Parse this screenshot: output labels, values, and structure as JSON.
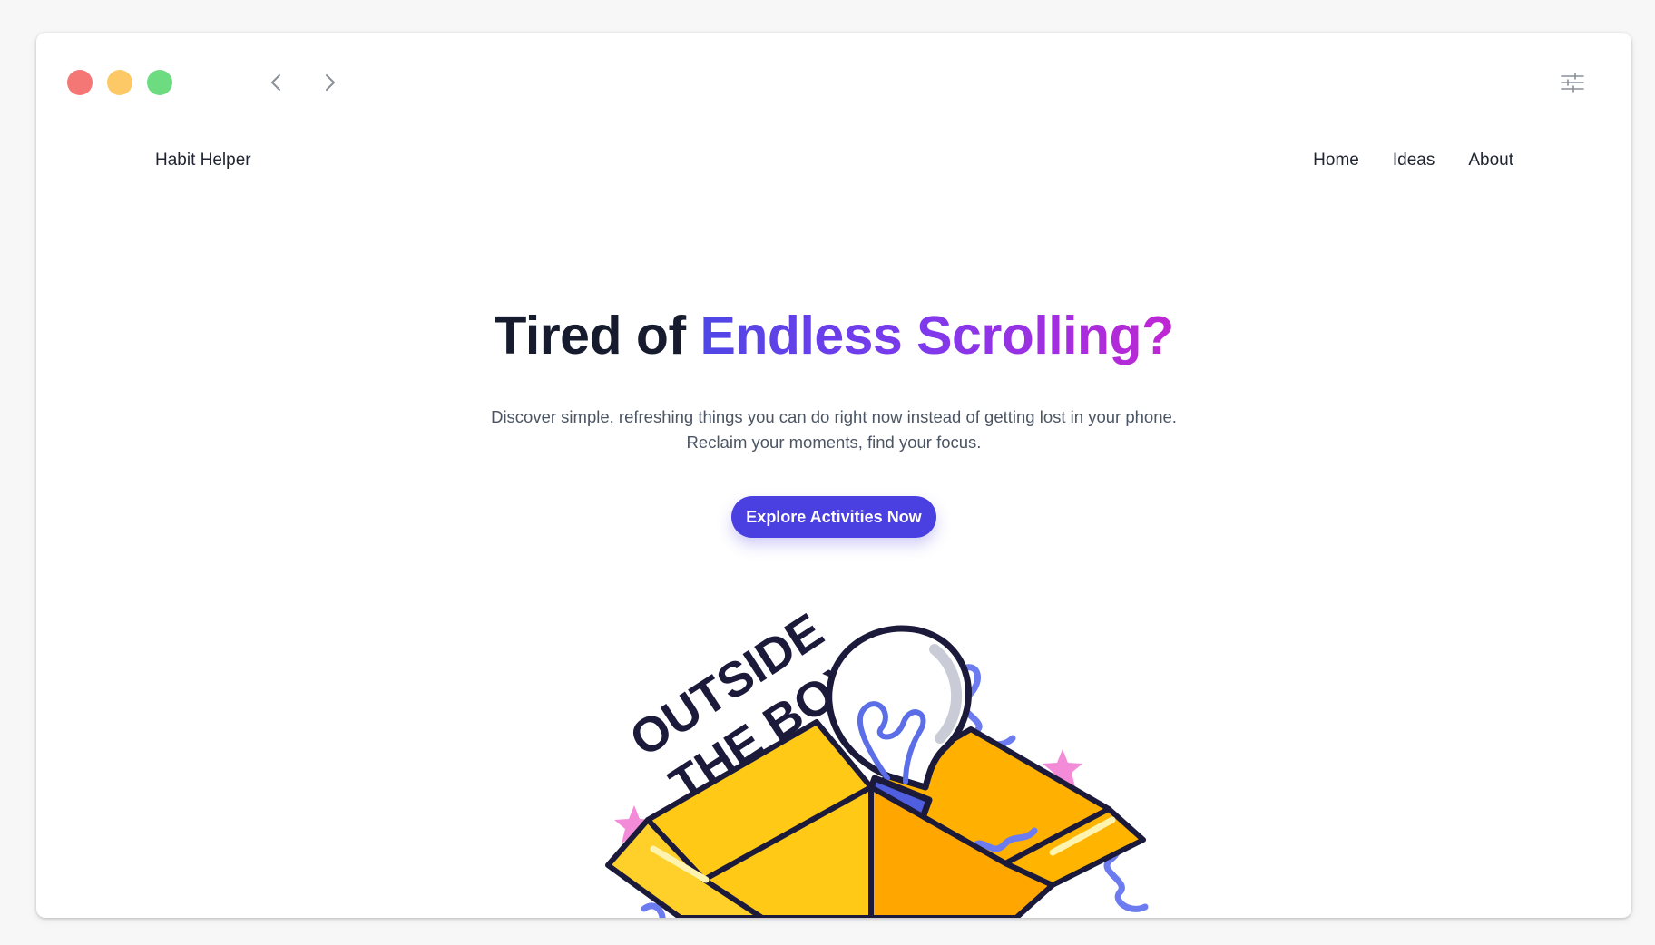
{
  "window": {
    "controls": [
      "close",
      "minimize",
      "zoom"
    ],
    "colors": {
      "close": "#f47775",
      "minimize": "#fdc967",
      "zoom": "#6ddc80"
    },
    "icons": {
      "back": "chevron-left-icon",
      "forward": "chevron-right-icon",
      "settings": "sliders-icon"
    }
  },
  "nav": {
    "brand": "Habit Helper",
    "links": [
      "Home",
      "Ideas",
      "About"
    ]
  },
  "hero": {
    "title_plain": "Tired of ",
    "title_highlight": "Endless Scrolling?",
    "subtitle_line1": "Discover simple, refreshing things you can do right now instead of getting lost in your phone.",
    "subtitle_line2": "Reclaim your moments, find your focus.",
    "cta_label": "Explore Activities Now",
    "accent_color": "#4a3fe0",
    "gradient": [
      "#4f46e5",
      "#7c3aed",
      "#c026d3"
    ]
  },
  "illustration": {
    "text_line1": "OUTSIDE",
    "text_line2": "THE BOX"
  }
}
